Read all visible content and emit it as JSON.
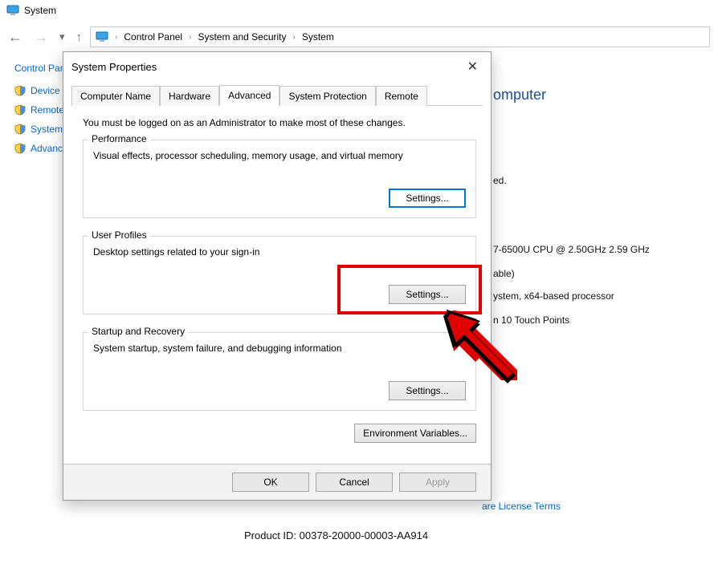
{
  "window": {
    "title": "System"
  },
  "breadcrumbs": {
    "a": "Control Panel",
    "b": "System and Security",
    "c": "System"
  },
  "sidebar": {
    "home": "Control Panel Home",
    "items": [
      "Device Manager",
      "Remote settings",
      "System protection",
      "Advanced system settings"
    ]
  },
  "heading_suffix": "omputer",
  "peek": {
    "ed": "ed.",
    "cpu": "7-6500U CPU @ 2.50GHz   2.59 GHz",
    "usable": "able)",
    "systype": "ystem, x64-based processor",
    "touch": "n 10 Touch Points",
    "lic": "are License Terms",
    "product": "Product ID: 00378-20000-00003-AA914"
  },
  "dialog": {
    "title": "System Properties",
    "tabs": {
      "cn": "Computer Name",
      "hw": "Hardware",
      "adv": "Advanced",
      "sp": "System Protection",
      "rm": "Remote"
    },
    "admin_note": "You must be logged on as an Administrator to make most of these changes.",
    "perf": {
      "label": "Performance",
      "desc": "Visual effects, processor scheduling, memory usage, and virtual memory",
      "btn": "Settings..."
    },
    "prof": {
      "label": "User Profiles",
      "desc": "Desktop settings related to your sign-in",
      "btn": "Settings..."
    },
    "start": {
      "label": "Startup and Recovery",
      "desc": "System startup, system failure, and debugging information",
      "btn": "Settings..."
    },
    "env_btn": "Environment Variables...",
    "footer": {
      "ok": "OK",
      "cancel": "Cancel",
      "apply": "Apply"
    }
  }
}
